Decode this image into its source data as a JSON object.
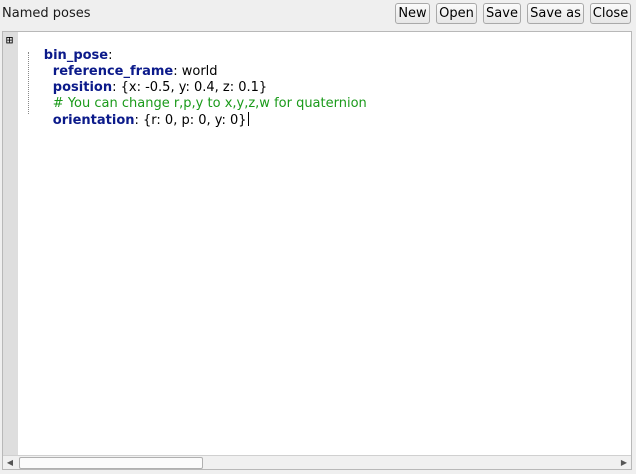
{
  "header": {
    "title": "Named poses",
    "buttons": [
      {
        "label": "New"
      },
      {
        "label": "Open"
      },
      {
        "label": "Save"
      },
      {
        "label": "Save as"
      },
      {
        "label": "Close"
      }
    ]
  },
  "editor": {
    "fold_marker": "⊞",
    "lines": [
      {
        "key": "bin_pose",
        "sep": ":",
        "value": ""
      },
      {
        "key": "reference_frame",
        "sep": ": ",
        "value": "world"
      },
      {
        "key": "position",
        "sep": ": ",
        "value": "{x: -0.5, y: 0.4, z: 0.1}"
      },
      {
        "comment": "# You can change r,p,y to x,y,z,w for quaternion"
      },
      {
        "key": "orientation",
        "sep": ": ",
        "value": "{r: 0, p: 0, y: 0}"
      }
    ]
  },
  "scrollbar": {
    "left_arrow": "◀",
    "right_arrow": "▶"
  }
}
